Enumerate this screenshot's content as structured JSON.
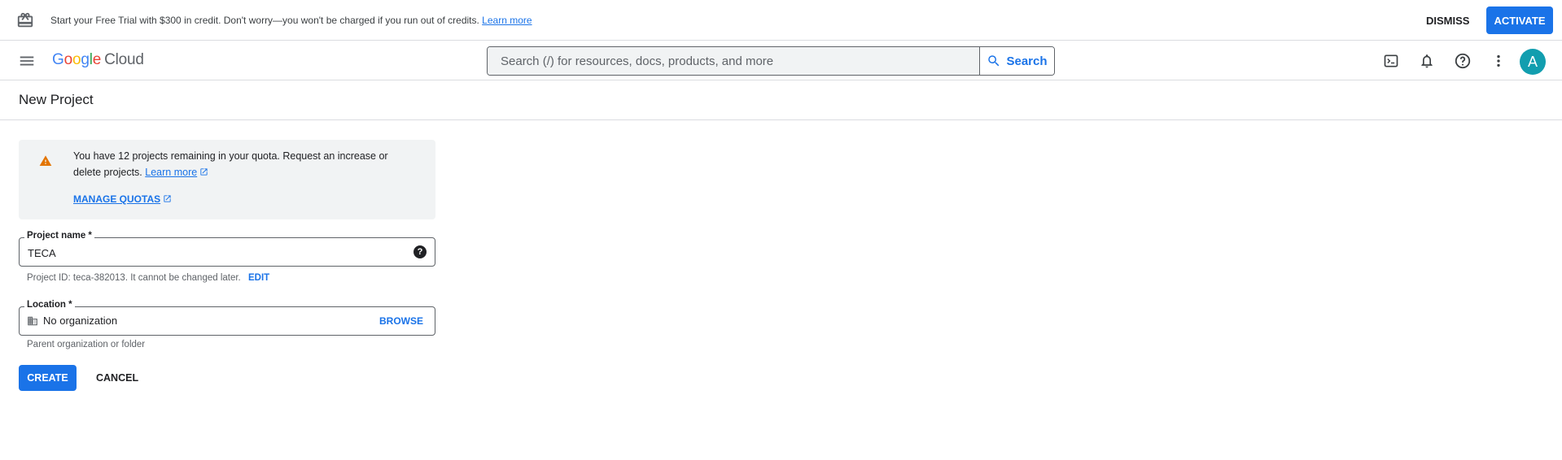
{
  "banner": {
    "message": "Start your Free Trial with $300 in credit. Don't worry—you won't be charged if you run out of credits.",
    "learn_more": "Learn more",
    "dismiss_label": "DISMISS",
    "activate_label": "ACTIVATE"
  },
  "header": {
    "logo_g": "G",
    "logo_o1": "o",
    "logo_o2": "o",
    "logo_g2": "g",
    "logo_l": "l",
    "logo_e": "e",
    "logo_product": "Cloud",
    "search_placeholder": "Search (/) for resources, docs, products, and more",
    "search_label": "Search",
    "avatar_initial": "A"
  },
  "page": {
    "title": "New Project"
  },
  "notice": {
    "text": "You have 12 projects remaining in your quota. Request an increase or delete projects.",
    "learn_more": "Learn more",
    "manage_quotas": "MANAGE QUOTAS"
  },
  "form": {
    "project_name_label": "Project name *",
    "project_name_value": "TECA",
    "project_id_text": "Project ID: teca-382013. It cannot be changed later.",
    "edit_label": "EDIT",
    "location_label": "Location *",
    "location_value": "No organization",
    "browse_label": "BROWSE",
    "location_hint": "Parent organization or folder",
    "create_label": "CREATE",
    "cancel_label": "CANCEL"
  },
  "icons": {
    "banner": "gift-icon",
    "menu": "hamburger-menu-icon",
    "search": "magnifier-icon",
    "terminal": "cloud-shell-icon",
    "notifications": "bell-icon",
    "help": "help-circle-icon",
    "more": "more-vert-icon",
    "warning": "warning-triangle-icon",
    "external": "external-link-icon",
    "location": "building-icon"
  },
  "colors": {
    "accent": "#1a73e8",
    "warning": "#e37400",
    "avatar": "#129eaf"
  }
}
